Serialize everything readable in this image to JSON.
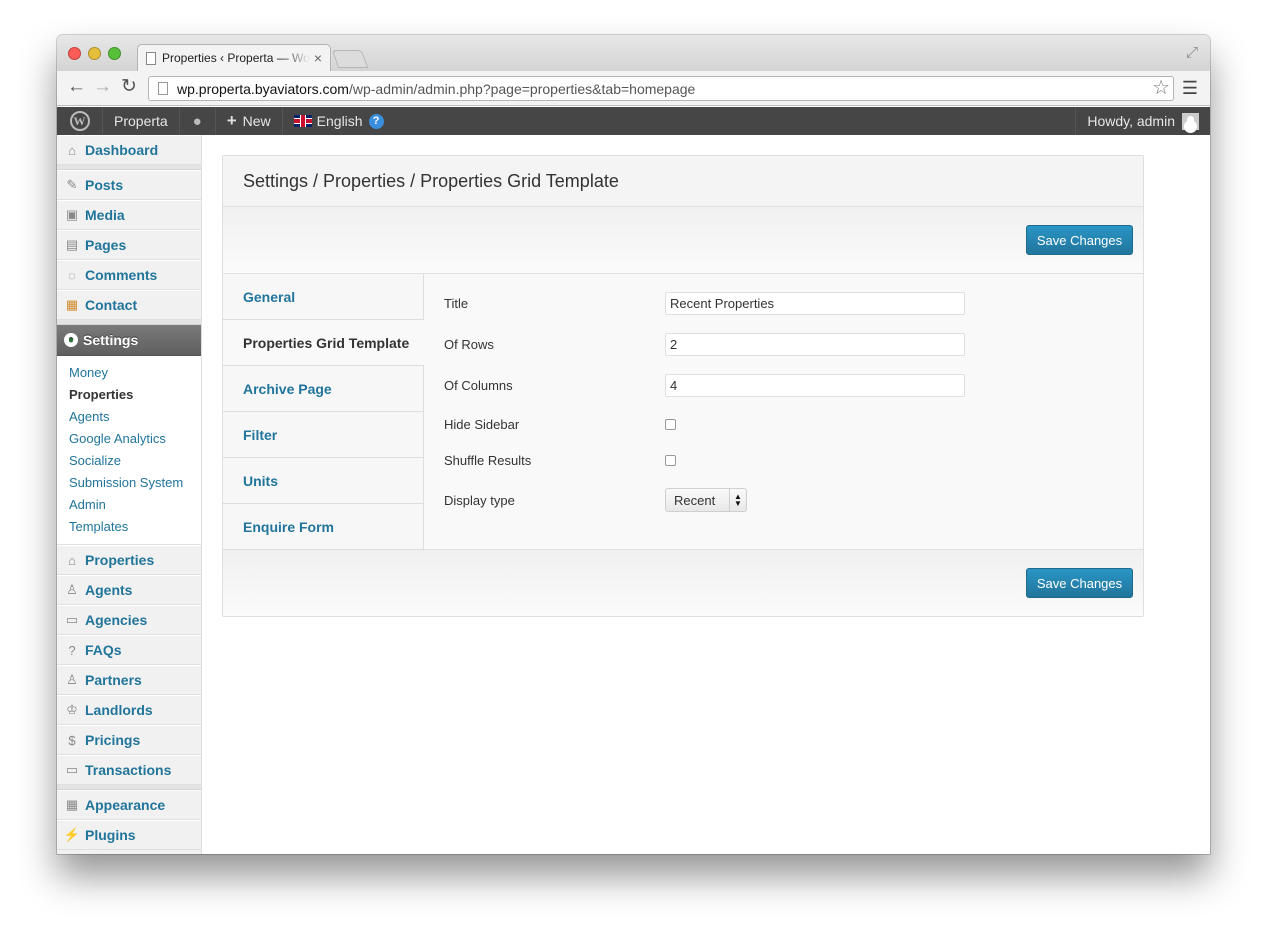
{
  "browser": {
    "tab_title": "Properties ‹ Properta — WordPress",
    "tab_close": "×",
    "url_host": "wp.properta.byaviators.com",
    "url_path": "/wp-admin/admin.php?page=properties&tab=homepage",
    "icons": [
      "back-icon",
      "forward-icon",
      "reload-icon",
      "star-icon",
      "menu-icon",
      "fullscreen-icon"
    ]
  },
  "adminbar": {
    "site_name": "Properta",
    "new_label": "New",
    "language": "English",
    "howdy": "Howdy, admin"
  },
  "sidebar": {
    "top_items": [
      {
        "label": "Dashboard"
      },
      {
        "label": "Posts"
      },
      {
        "label": "Media"
      },
      {
        "label": "Pages"
      },
      {
        "label": "Comments"
      },
      {
        "label": "Contact"
      }
    ],
    "current": "Settings",
    "submenu": [
      "Money",
      "Properties",
      "Agents",
      "Google Analytics",
      "Socialize",
      "Submission System",
      "Admin",
      "Templates"
    ],
    "active_submenu": "Properties",
    "items_after": [
      "Properties",
      "Agents",
      "Agencies",
      "FAQs",
      "Partners",
      "Landlords",
      "Pricings",
      "Transactions"
    ],
    "bottom_items": [
      "Appearance",
      "Plugins"
    ]
  },
  "panel": {
    "title": "Settings / Properties / Properties Grid Template",
    "save_label": "Save Changes",
    "tabs": [
      "General",
      "Properties Grid Template",
      "Archive Page",
      "Filter",
      "Units",
      "Enquire Form"
    ],
    "active_tab": "Properties Grid Template",
    "fields": {
      "title_label": "Title",
      "title_value": "Recent Properties",
      "rows_label": "Of Rows",
      "rows_value": "2",
      "columns_label": "Of Columns",
      "columns_value": "4",
      "hide_sidebar_label": "Hide Sidebar",
      "hide_sidebar_checked": false,
      "shuffle_label": "Shuffle Results",
      "shuffle_checked": false,
      "display_type_label": "Display type",
      "display_type_value": "Recent"
    }
  },
  "colors": {
    "link": "#21759b",
    "adminbar": "#464646",
    "button": "#2a95c5"
  }
}
